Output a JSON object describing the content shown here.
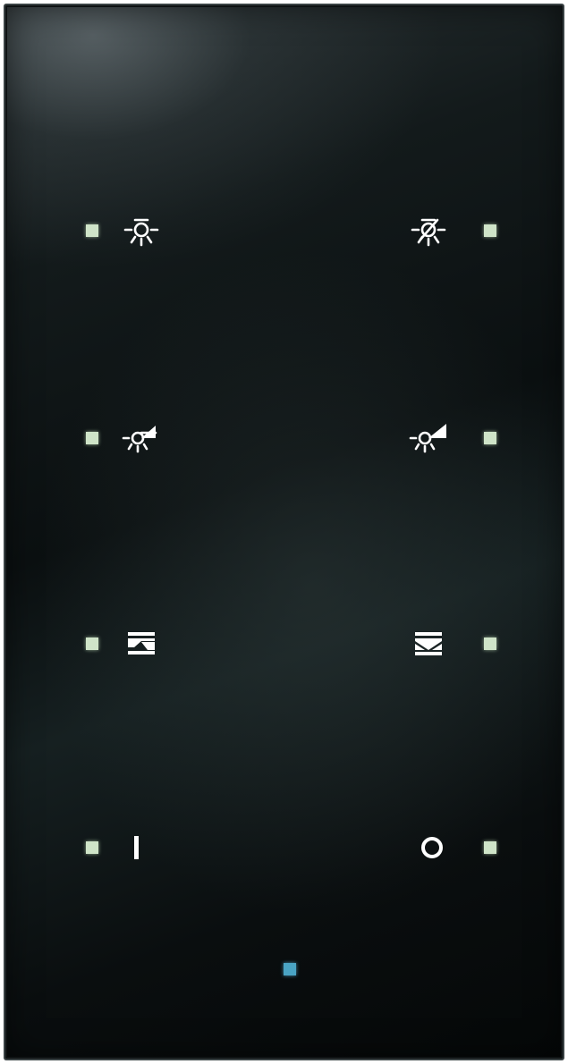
{
  "device": {
    "type": "glass-touch-panel",
    "colors": {
      "glass": "#0b1011",
      "status_led": "#cfe4c8",
      "status_led_central": "#4aa4c4",
      "icon": "#ffffff"
    }
  },
  "buttons": [
    {
      "position": "row1-left",
      "icon": "light-on-icon"
    },
    {
      "position": "row1-right",
      "icon": "light-off-icon"
    },
    {
      "position": "row2-left",
      "icon": "dim-up-icon"
    },
    {
      "position": "row2-right",
      "icon": "dim-down-icon"
    },
    {
      "position": "row3-left",
      "icon": "blind-up-icon"
    },
    {
      "position": "row3-right",
      "icon": "blind-down-icon"
    },
    {
      "position": "row4-left",
      "icon": "on-icon"
    },
    {
      "position": "row4-right",
      "icon": "off-icon"
    }
  ],
  "central_led": {
    "icon": "status-led-icon"
  }
}
